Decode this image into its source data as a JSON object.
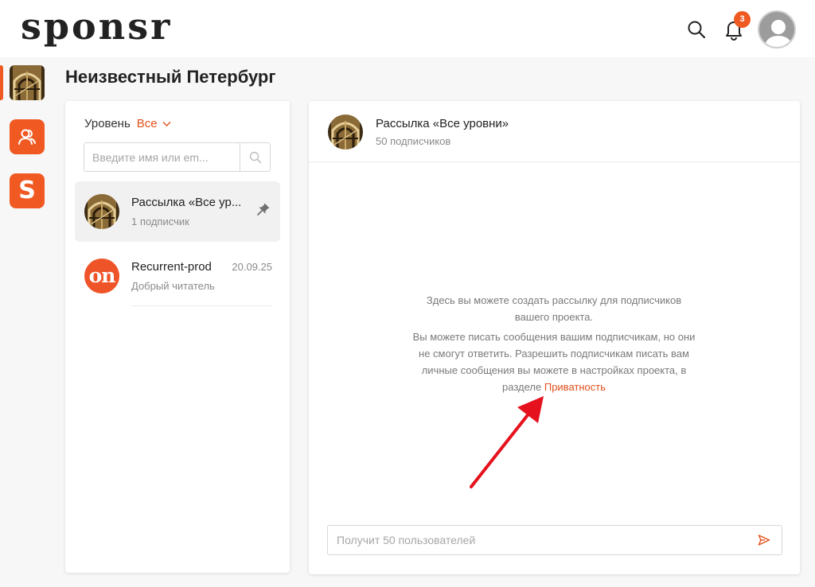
{
  "header": {
    "logo": "sponsr",
    "notifications_count": "3"
  },
  "project": {
    "title": "Неизвестный Петербург"
  },
  "sidebar": {
    "sponsr_letter": "S"
  },
  "filter": {
    "level_label": "Уровень",
    "level_value": "Все"
  },
  "search": {
    "placeholder": "Введите имя или em..."
  },
  "conversations": [
    {
      "title": "Рассылка «Все ур...",
      "subtitle": "1 подписчик",
      "date": ""
    },
    {
      "title": "Recurrent-prod",
      "subtitle": "Добрый читатель",
      "date": "20.09.25",
      "avatar_text": "on"
    }
  ],
  "chat": {
    "title": "Рассылка «Все уровни»",
    "subtitle": "50 подписчиков",
    "info_line1": "Здесь вы можете создать рассылку для подписчиков вашего проекта.",
    "info_line2": "Вы можете писать сообщения вашим подписчикам, но они не смогут ответить. Разрешить подписчикам писать вам личные сообщения вы можете в настройках проекта, в разделе",
    "privacy_link": "Приватность",
    "compose_placeholder": "Получит 50 пользователей"
  },
  "colors": {
    "accent": "#f05a22",
    "link": "#e2501c",
    "annotation_arrow": "#e5121d"
  }
}
